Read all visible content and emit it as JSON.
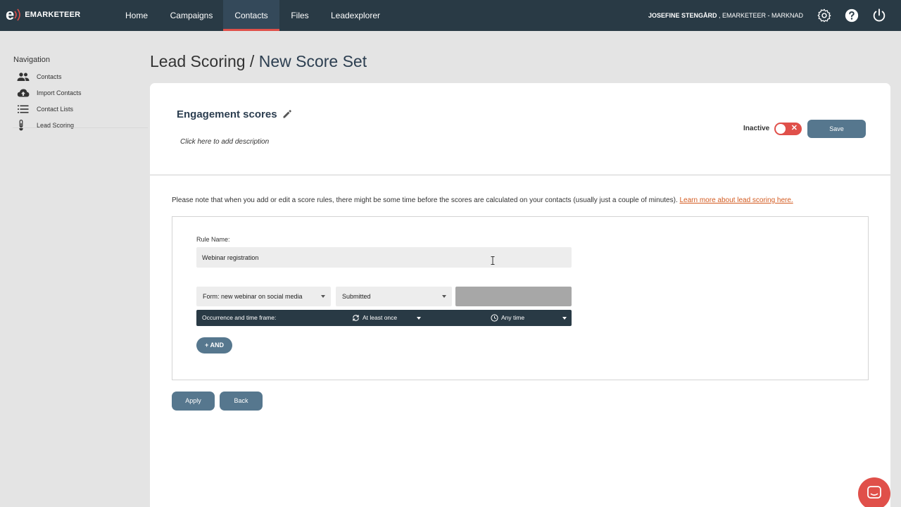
{
  "app": {
    "brand_letter": "e",
    "brand_name": "EMARKETEER"
  },
  "topnav": {
    "tabs": [
      {
        "label": "Home"
      },
      {
        "label": "Campaigns"
      },
      {
        "label": "Contacts",
        "active": true
      },
      {
        "label": "Files"
      },
      {
        "label": "Leadexplorer"
      }
    ],
    "user_name": "JOSEFINE STENGÅRD",
    "user_org": " , EMARKETEER - MARKNAD",
    "icons": [
      "gear-icon",
      "help-icon",
      "power-icon"
    ]
  },
  "sidebar": {
    "title": "Navigation",
    "items": [
      {
        "label": "Contacts",
        "icon": "people-icon"
      },
      {
        "label": "Import Contacts",
        "icon": "cloud-upload-icon"
      },
      {
        "label": "Contact Lists",
        "icon": "list-icon"
      },
      {
        "label": "Lead Scoring",
        "icon": "thermometer-icon"
      }
    ]
  },
  "page": {
    "breadcrumb_parent": "Lead Scoring",
    "breadcrumb_sep": " / ",
    "breadcrumb_current": "New Score Set"
  },
  "score_set": {
    "name": "Engagement scores",
    "description_placeholder": "Click here to add description",
    "status_label": "Inactive",
    "status_active": false,
    "save_label": "Save"
  },
  "note": {
    "text": "Please note that when you add or edit a score rules, there might be some time before the scores are calculated on your contacts (usually just a couple of minutes). ",
    "link": "Learn more about lead scoring here."
  },
  "rule": {
    "name_label": "Rule Name:",
    "name_value": "Webinar registration",
    "condition_source": "Form: new webinar on social media",
    "condition_event": "Submitted",
    "condition_value": "",
    "occurrence_label": "Occurrence and time frame:",
    "occurrence_value": "At least once",
    "timeframe_value": "Any time",
    "and_label": "+ AND"
  },
  "footer_buttons": {
    "apply": "Apply",
    "back": "Back"
  },
  "colors": {
    "topbar": "#293a45",
    "accent": "#e0504a",
    "button": "#56778e",
    "link": "#d35a1f"
  }
}
